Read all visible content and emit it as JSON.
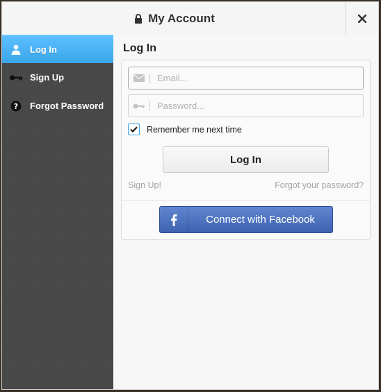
{
  "header": {
    "title": "My Account",
    "lock_icon": "lock-icon",
    "close_icon": "close-icon"
  },
  "sidebar": {
    "items": [
      {
        "label": "Log In",
        "icon": "user-icon",
        "active": true
      },
      {
        "label": "Sign Up",
        "icon": "key-icon",
        "active": false
      },
      {
        "label": "Forgot Password",
        "icon": "question-icon",
        "active": false
      }
    ]
  },
  "main": {
    "title": "Log In",
    "email": {
      "value": "",
      "placeholder": "Email..."
    },
    "password": {
      "value": "",
      "placeholder": "Password..."
    },
    "remember": {
      "label": "Remember me next time",
      "checked": true
    },
    "login_button": "Log In",
    "signup_link": "Sign Up!",
    "forgot_link": "Forgot your password?",
    "facebook_button": "Connect with Facebook",
    "facebook_icon": "f"
  },
  "colors": {
    "accent": "#3aa6ea",
    "sidebar": "#474747",
    "facebook": "#4a6fc0"
  }
}
